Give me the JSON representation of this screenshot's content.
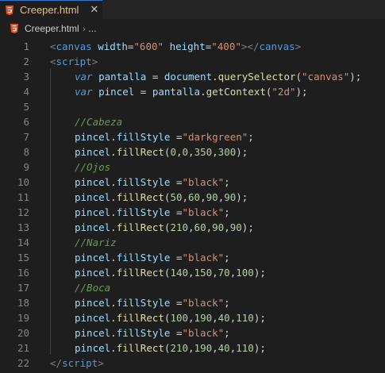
{
  "tab": {
    "title": "Creeper.html",
    "close": "✕"
  },
  "breadcrumb": {
    "file": "Creeper.html",
    "separator": "›",
    "more": "..."
  },
  "colors": {
    "accent": "#2b79d6",
    "html_icon": "#e44d26",
    "tab_title": "#e2c08d"
  },
  "lines": [
    {
      "n": "1",
      "indent": 0,
      "tokens": [
        {
          "t": "<",
          "c": "tag"
        },
        {
          "t": "canvas",
          "c": "tn"
        },
        {
          "t": " ",
          "c": "pl"
        },
        {
          "t": "width",
          "c": "at"
        },
        {
          "t": "=",
          "c": "pl"
        },
        {
          "t": "\"600\"",
          "c": "str"
        },
        {
          "t": " ",
          "c": "pl"
        },
        {
          "t": "height",
          "c": "at"
        },
        {
          "t": "=",
          "c": "pl"
        },
        {
          "t": "\"400\"",
          "c": "str"
        },
        {
          "t": "></",
          "c": "tag"
        },
        {
          "t": "canvas",
          "c": "tn"
        },
        {
          "t": ">",
          "c": "tag"
        }
      ]
    },
    {
      "n": "2",
      "indent": 0,
      "tokens": [
        {
          "t": "<",
          "c": "tag"
        },
        {
          "t": "script",
          "c": "tn"
        },
        {
          "t": ">",
          "c": "tag"
        }
      ]
    },
    {
      "n": "3",
      "indent": 1,
      "tokens": [
        {
          "t": "var",
          "c": "kw"
        },
        {
          "t": " ",
          "c": "pl"
        },
        {
          "t": "pantalla",
          "c": "var"
        },
        {
          "t": " = ",
          "c": "pl"
        },
        {
          "t": "document",
          "c": "var"
        },
        {
          "t": ".",
          "c": "pl"
        },
        {
          "t": "querySelector",
          "c": "fn"
        },
        {
          "t": "(",
          "c": "pl"
        },
        {
          "t": "\"canvas\"",
          "c": "str"
        },
        {
          "t": ");",
          "c": "pl"
        }
      ]
    },
    {
      "n": "4",
      "indent": 1,
      "tokens": [
        {
          "t": "var",
          "c": "kw"
        },
        {
          "t": " ",
          "c": "pl"
        },
        {
          "t": "pincel",
          "c": "var"
        },
        {
          "t": " = ",
          "c": "pl"
        },
        {
          "t": "pantalla",
          "c": "var"
        },
        {
          "t": ".",
          "c": "pl"
        },
        {
          "t": "getContext",
          "c": "fn"
        },
        {
          "t": "(",
          "c": "pl"
        },
        {
          "t": "\"2d\"",
          "c": "str"
        },
        {
          "t": ");",
          "c": "pl"
        }
      ]
    },
    {
      "n": "5",
      "indent": 0,
      "tokens": []
    },
    {
      "n": "6",
      "indent": 1,
      "tokens": [
        {
          "t": "//Cabeza",
          "c": "cmt"
        }
      ]
    },
    {
      "n": "7",
      "indent": 1,
      "tokens": [
        {
          "t": "pincel",
          "c": "var"
        },
        {
          "t": ".",
          "c": "pl"
        },
        {
          "t": "fillStyle",
          "c": "var"
        },
        {
          "t": " =",
          "c": "pl"
        },
        {
          "t": "\"darkgreen\"",
          "c": "str"
        },
        {
          "t": ";",
          "c": "pl"
        }
      ]
    },
    {
      "n": "8",
      "indent": 1,
      "tokens": [
        {
          "t": "pincel",
          "c": "var"
        },
        {
          "t": ".",
          "c": "pl"
        },
        {
          "t": "fillRect",
          "c": "fn"
        },
        {
          "t": "(",
          "c": "pl"
        },
        {
          "t": "0",
          "c": "num"
        },
        {
          "t": ",",
          "c": "pl"
        },
        {
          "t": "0",
          "c": "num"
        },
        {
          "t": ",",
          "c": "pl"
        },
        {
          "t": "350",
          "c": "num"
        },
        {
          "t": ",",
          "c": "pl"
        },
        {
          "t": "300",
          "c": "num"
        },
        {
          "t": ");",
          "c": "pl"
        }
      ]
    },
    {
      "n": "9",
      "indent": 1,
      "tokens": [
        {
          "t": "//Ojos",
          "c": "cmt"
        }
      ]
    },
    {
      "n": "10",
      "indent": 1,
      "tokens": [
        {
          "t": "pincel",
          "c": "var"
        },
        {
          "t": ".",
          "c": "pl"
        },
        {
          "t": "fillStyle",
          "c": "var"
        },
        {
          "t": " =",
          "c": "pl"
        },
        {
          "t": "\"black\"",
          "c": "str"
        },
        {
          "t": ";",
          "c": "pl"
        }
      ]
    },
    {
      "n": "11",
      "indent": 1,
      "tokens": [
        {
          "t": "pincel",
          "c": "var"
        },
        {
          "t": ".",
          "c": "pl"
        },
        {
          "t": "fillRect",
          "c": "fn"
        },
        {
          "t": "(",
          "c": "pl"
        },
        {
          "t": "50",
          "c": "num"
        },
        {
          "t": ",",
          "c": "pl"
        },
        {
          "t": "60",
          "c": "num"
        },
        {
          "t": ",",
          "c": "pl"
        },
        {
          "t": "90",
          "c": "num"
        },
        {
          "t": ",",
          "c": "pl"
        },
        {
          "t": "90",
          "c": "num"
        },
        {
          "t": ");",
          "c": "pl"
        }
      ]
    },
    {
      "n": "12",
      "indent": 1,
      "tokens": [
        {
          "t": "pincel",
          "c": "var"
        },
        {
          "t": ".",
          "c": "pl"
        },
        {
          "t": "fillStyle",
          "c": "var"
        },
        {
          "t": " =",
          "c": "pl"
        },
        {
          "t": "\"black\"",
          "c": "str"
        },
        {
          "t": ";",
          "c": "pl"
        }
      ]
    },
    {
      "n": "13",
      "indent": 1,
      "tokens": [
        {
          "t": "pincel",
          "c": "var"
        },
        {
          "t": ".",
          "c": "pl"
        },
        {
          "t": "fillRect",
          "c": "fn"
        },
        {
          "t": "(",
          "c": "pl"
        },
        {
          "t": "210",
          "c": "num"
        },
        {
          "t": ",",
          "c": "pl"
        },
        {
          "t": "60",
          "c": "num"
        },
        {
          "t": ",",
          "c": "pl"
        },
        {
          "t": "90",
          "c": "num"
        },
        {
          "t": ",",
          "c": "pl"
        },
        {
          "t": "90",
          "c": "num"
        },
        {
          "t": ");",
          "c": "pl"
        }
      ]
    },
    {
      "n": "14",
      "indent": 1,
      "tokens": [
        {
          "t": "//Nariz",
          "c": "cmt"
        }
      ]
    },
    {
      "n": "15",
      "indent": 1,
      "tokens": [
        {
          "t": "pincel",
          "c": "var"
        },
        {
          "t": ".",
          "c": "pl"
        },
        {
          "t": "fillStyle",
          "c": "var"
        },
        {
          "t": " =",
          "c": "pl"
        },
        {
          "t": "\"black\"",
          "c": "str"
        },
        {
          "t": ";",
          "c": "pl"
        }
      ]
    },
    {
      "n": "16",
      "indent": 1,
      "tokens": [
        {
          "t": "pincel",
          "c": "var"
        },
        {
          "t": ".",
          "c": "pl"
        },
        {
          "t": "fillRect",
          "c": "fn"
        },
        {
          "t": "(",
          "c": "pl"
        },
        {
          "t": "140",
          "c": "num"
        },
        {
          "t": ",",
          "c": "pl"
        },
        {
          "t": "150",
          "c": "num"
        },
        {
          "t": ",",
          "c": "pl"
        },
        {
          "t": "70",
          "c": "num"
        },
        {
          "t": ",",
          "c": "pl"
        },
        {
          "t": "100",
          "c": "num"
        },
        {
          "t": ");",
          "c": "pl"
        }
      ]
    },
    {
      "n": "17",
      "indent": 1,
      "tokens": [
        {
          "t": "//Boca",
          "c": "cmt"
        }
      ]
    },
    {
      "n": "18",
      "indent": 1,
      "tokens": [
        {
          "t": "pincel",
          "c": "var"
        },
        {
          "t": ".",
          "c": "pl"
        },
        {
          "t": "fillStyle",
          "c": "var"
        },
        {
          "t": " =",
          "c": "pl"
        },
        {
          "t": "\"black\"",
          "c": "str"
        },
        {
          "t": ";",
          "c": "pl"
        }
      ]
    },
    {
      "n": "19",
      "indent": 1,
      "tokens": [
        {
          "t": "pincel",
          "c": "var"
        },
        {
          "t": ".",
          "c": "pl"
        },
        {
          "t": "fillRect",
          "c": "fn"
        },
        {
          "t": "(",
          "c": "pl"
        },
        {
          "t": "100",
          "c": "num"
        },
        {
          "t": ",",
          "c": "pl"
        },
        {
          "t": "190",
          "c": "num"
        },
        {
          "t": ",",
          "c": "pl"
        },
        {
          "t": "40",
          "c": "num"
        },
        {
          "t": ",",
          "c": "pl"
        },
        {
          "t": "110",
          "c": "num"
        },
        {
          "t": ");",
          "c": "pl"
        }
      ]
    },
    {
      "n": "20",
      "indent": 1,
      "tokens": [
        {
          "t": "pincel",
          "c": "var"
        },
        {
          "t": ".",
          "c": "pl"
        },
        {
          "t": "fillStyle",
          "c": "var"
        },
        {
          "t": " =",
          "c": "pl"
        },
        {
          "t": "\"black\"",
          "c": "str"
        },
        {
          "t": ";",
          "c": "pl"
        }
      ]
    },
    {
      "n": "21",
      "indent": 1,
      "tokens": [
        {
          "t": "pincel",
          "c": "var"
        },
        {
          "t": ".",
          "c": "pl"
        },
        {
          "t": "fillRect",
          "c": "fn"
        },
        {
          "t": "(",
          "c": "pl"
        },
        {
          "t": "210",
          "c": "num"
        },
        {
          "t": ",",
          "c": "pl"
        },
        {
          "t": "190",
          "c": "num"
        },
        {
          "t": ",",
          "c": "pl"
        },
        {
          "t": "40",
          "c": "num"
        },
        {
          "t": ",",
          "c": "pl"
        },
        {
          "t": "110",
          "c": "num"
        },
        {
          "t": ");",
          "c": "pl"
        }
      ]
    },
    {
      "n": "22",
      "indent": 0,
      "tokens": [
        {
          "t": "</",
          "c": "tag"
        },
        {
          "t": "script",
          "c": "tn"
        },
        {
          "t": ">",
          "c": "tag"
        }
      ]
    }
  ]
}
